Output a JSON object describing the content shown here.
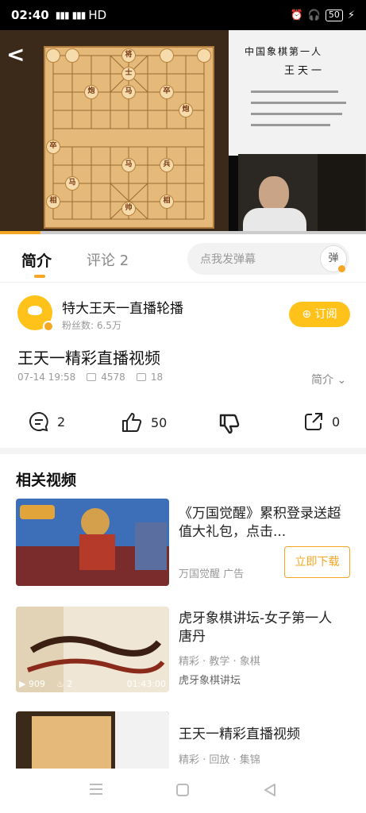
{
  "status_bar": {
    "time": "02:40",
    "network": "HD",
    "battery": "50"
  },
  "video": {
    "poster_title": "中国象棋第一人",
    "poster_name": "王天一",
    "progress": 0.11
  },
  "tabs": [
    {
      "label": "简介",
      "active": true
    },
    {
      "label": "评论",
      "count": "2",
      "active": false
    }
  ],
  "danmu": {
    "placeholder": "点我发弹幕",
    "button": "弹"
  },
  "channel": {
    "name": "特大王天一直播轮播",
    "fans": "粉丝数: 6.5万",
    "subscribe": "订阅"
  },
  "video_info": {
    "title": "王天一精彩直播视频",
    "date": "07-14 19:58",
    "plays": "4578",
    "danmaku": "18",
    "intro": "简介"
  },
  "actions": {
    "comments": "2",
    "likes": "50",
    "dislike": "",
    "shares": "0"
  },
  "related": {
    "title": "相关视频",
    "items": [
      {
        "title": "《万国觉醒》累积登录送超值大礼包，点击...",
        "author": "万国觉醒",
        "tag": "广告",
        "button": "立即下载"
      },
      {
        "title": "虎牙象棋讲坛-女子第一人唐丹",
        "tags": "精彩 · 教学 · 象棋",
        "author": "虎牙象棋讲坛",
        "plays": "909",
        "likes": "2",
        "duration": "01:43:00"
      },
      {
        "title": "王天一精彩直播视频",
        "tags": "精彩 · 回放 · 集锦"
      }
    ]
  },
  "colors": {
    "accent": "#f5a623",
    "subscribe_bg": "#ffc21a"
  }
}
